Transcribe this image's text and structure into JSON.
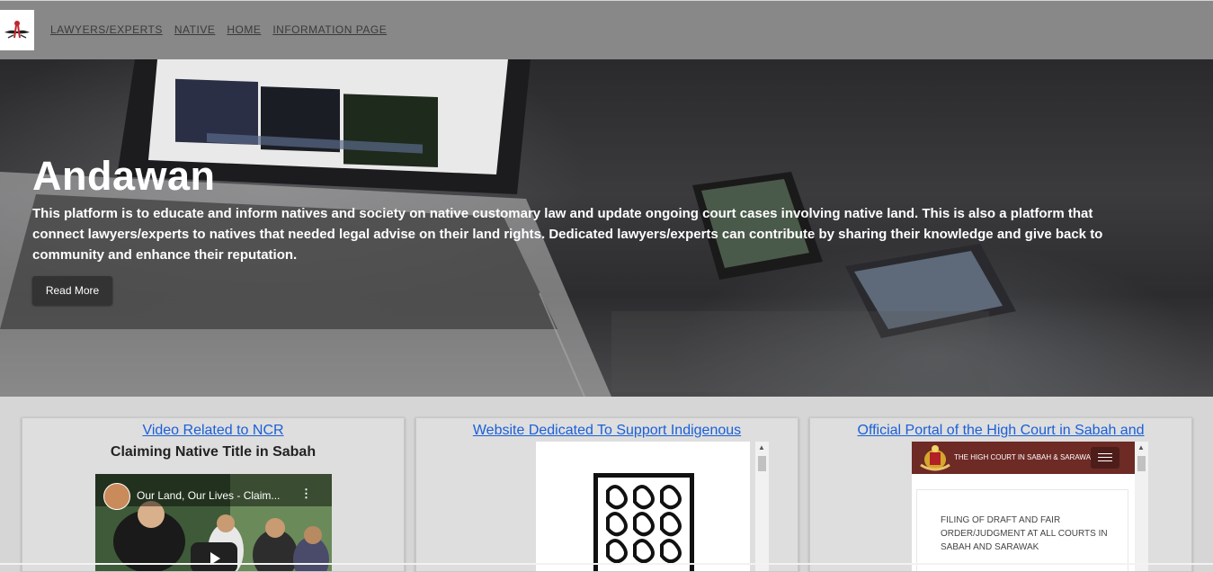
{
  "nav": {
    "links": [
      "LAWYERS/EXPERTS",
      "NATIVE",
      "HOME",
      "INFORMATION PAGE"
    ]
  },
  "hero": {
    "title": "Andawan",
    "description": "This platform is to educate and inform natives and society on native customary law and update ongoing court cases involving native land. This is also a platform that connect lawyers/experts to natives that needed legal advise on their land rights. Dedicated lawyers/experts can contribute by sharing their knowledge and give back to community and enhance their reputation.",
    "button_label": "Read More"
  },
  "cards": [
    {
      "title": "Video Related to NCR",
      "subtitle": "Claiming Native Title in Sabah",
      "video_title": "Our Land, Our Lives - Claim..."
    },
    {
      "title": "Website Dedicated To Support Indigenous"
    },
    {
      "title": "Official Portal of the High Court in Sabah and",
      "site_header": "THE HIGH COURT IN SABAH & SARAWAK",
      "notice": "FILING OF DRAFT AND FAIR ORDER/JUDGMENT AT ALL COURTS IN SABAH AND SARAWAK"
    }
  ],
  "colors": {
    "nav_bg": "#888888",
    "link_blue": "#1a5fd8",
    "court_red": "#6e2a25"
  }
}
